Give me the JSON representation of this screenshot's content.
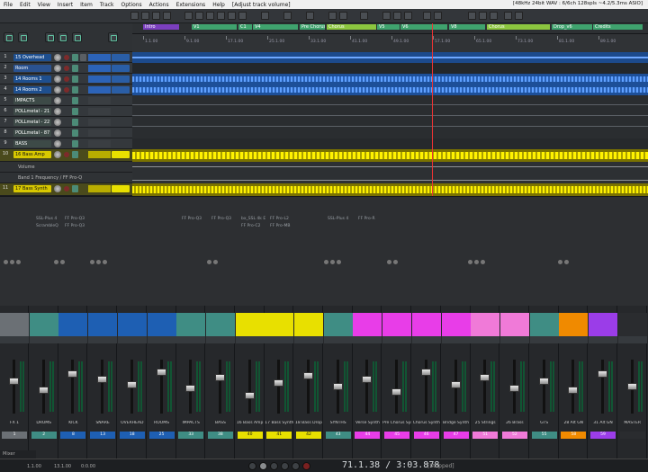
{
  "menubar": {
    "items": [
      "File",
      "Edit",
      "View",
      "Insert",
      "Item",
      "Track",
      "Options",
      "Actions",
      "Extensions",
      "Help"
    ],
    "title": "[Adjust track volume]",
    "status": "[48kHz 24bit WAV : 6/6ch 128spls ~4.2/5.3ms ASIO]"
  },
  "regions": [
    {
      "label": "Intro",
      "color": "#7b3fbf"
    },
    {
      "label": "V1",
      "color": "#3fa36e"
    },
    {
      "label": "C1",
      "color": "#3fa36e"
    },
    {
      "label": "V4",
      "color": "#3fa36e"
    },
    {
      "label": "Pre Chorus",
      "color": "#3fa36e"
    },
    {
      "label": "Chorus",
      "color": "#8cc63f"
    },
    {
      "label": "V5",
      "color": "#3fa36e"
    },
    {
      "label": "V6",
      "color": "#3fa36e"
    },
    {
      "label": "V8",
      "color": "#3fa36e"
    },
    {
      "label": "Chorus",
      "color": "#8cc63f"
    },
    {
      "label": "Drop_v6",
      "color": "#3fa36e"
    },
    {
      "label": "Credits",
      "color": "#3fa36e"
    }
  ],
  "ruler_ticks": [
    "1.1.00",
    "9.1.00",
    "17.1.00",
    "25.1.00",
    "33.1.00",
    "41.1.00",
    "49.1.00",
    "57.1.00",
    "65.1.00",
    "73.1.00",
    "81.1.00",
    "89.1.00"
  ],
  "tracks": [
    {
      "num": "1",
      "name": "15 Overhead",
      "color": "#1e5fb3"
    },
    {
      "num": "2",
      "name": "Room",
      "color": "#1e5fb3"
    },
    {
      "num": "3",
      "name": "14 Rooms 1",
      "color": "#1e5fb3"
    },
    {
      "num": "4",
      "name": "14 Rooms 2",
      "color": "#1e5fb3"
    },
    {
      "num": "5",
      "name": "IMPACTS",
      "color": "#4a8c7a"
    },
    {
      "num": "6",
      "name": "POLLmetal - 21",
      "color": "#4a8c7a"
    },
    {
      "num": "7",
      "name": "POLLmetal - 22",
      "color": "#4a8c7a"
    },
    {
      "num": "8",
      "name": "POLLmetal - 87",
      "color": "#4a8c7a"
    },
    {
      "num": "9",
      "name": "BASS",
      "color": "#4a8c7a"
    },
    {
      "num": "10",
      "name": "16 Bass Amp",
      "color": "#d8c800"
    },
    {
      "num": "",
      "name": "Volume",
      "color": "#3a3d40"
    },
    {
      "num": "",
      "name": "Band 1 Frequency / FF Pro-Q",
      "color": "#3a3d40"
    },
    {
      "num": "11",
      "name": "17 Bass Synth",
      "color": "#d8c800"
    }
  ],
  "fx_labels": [
    "SSL-Plus 4",
    "ScrambleQ",
    "FF Pro-Q3",
    "FF Pro-Q3",
    "FF Pro-Q3",
    "FF Pro-Q3",
    "bx_SSL 4k E",
    "FF Pro-C2",
    "FF Pro-L2",
    "FF Pro-MB",
    "SSL-Plus 4",
    "FF Pro-R"
  ],
  "mixer_strips": [
    {
      "name": "FX 1",
      "num": "1",
      "color": "#6b7075"
    },
    {
      "name": "DRUMS",
      "num": "2",
      "color": "#3f8d84"
    },
    {
      "name": "KICK",
      "num": "8",
      "color": "#1e5fb3"
    },
    {
      "name": "SNARE",
      "num": "13",
      "color": "#1e5fb3"
    },
    {
      "name": "OVERHEAD",
      "num": "18",
      "color": "#1e5fb3"
    },
    {
      "name": "ROOMS",
      "num": "25",
      "color": "#1e5fb3"
    },
    {
      "name": "IMPACTS",
      "num": "33",
      "color": "#3f8d84"
    },
    {
      "name": "BASS",
      "num": "38",
      "color": "#3f8d84"
    },
    {
      "name": "16 Bass Amp",
      "num": "40",
      "color": "#e8e000"
    },
    {
      "name": "17 Bass Synth",
      "num": "41",
      "color": "#e8e000"
    },
    {
      "name": "18 Bass Drop",
      "num": "42",
      "color": "#e8e000"
    },
    {
      "name": "SYNTHS",
      "num": "43",
      "color": "#3f8d84"
    },
    {
      "name": "Verse Synth",
      "num": "44",
      "color": "#e83de8"
    },
    {
      "name": "Pre Chorus Syn",
      "num": "45",
      "color": "#e83de8"
    },
    {
      "name": "Chorus Synth",
      "num": "46",
      "color": "#e83de8"
    },
    {
      "name": "Bridge Synth",
      "num": "47",
      "color": "#e83de8"
    },
    {
      "name": "25 Strings",
      "num": "51",
      "color": "#f07ad8"
    },
    {
      "name": "26 Brass",
      "num": "52",
      "color": "#f07ad8"
    },
    {
      "name": "GTS",
      "num": "55",
      "color": "#3f8d84"
    },
    {
      "name": "28 Alt GN",
      "num": "58",
      "color": "#f08a00"
    },
    {
      "name": "31 Alt GN",
      "num": "59",
      "color": "#9b3de8"
    },
    {
      "name": "MASTER",
      "num": "",
      "color": "#2a2c2f"
    }
  ],
  "transport": {
    "timecode": "71.1.38 / 3:03.878",
    "state": "[Stopped]",
    "time_a": "1.1.00",
    "time_b": "13.1.00",
    "time_c": "0:0.00",
    "mixer_label": "Mixer"
  }
}
